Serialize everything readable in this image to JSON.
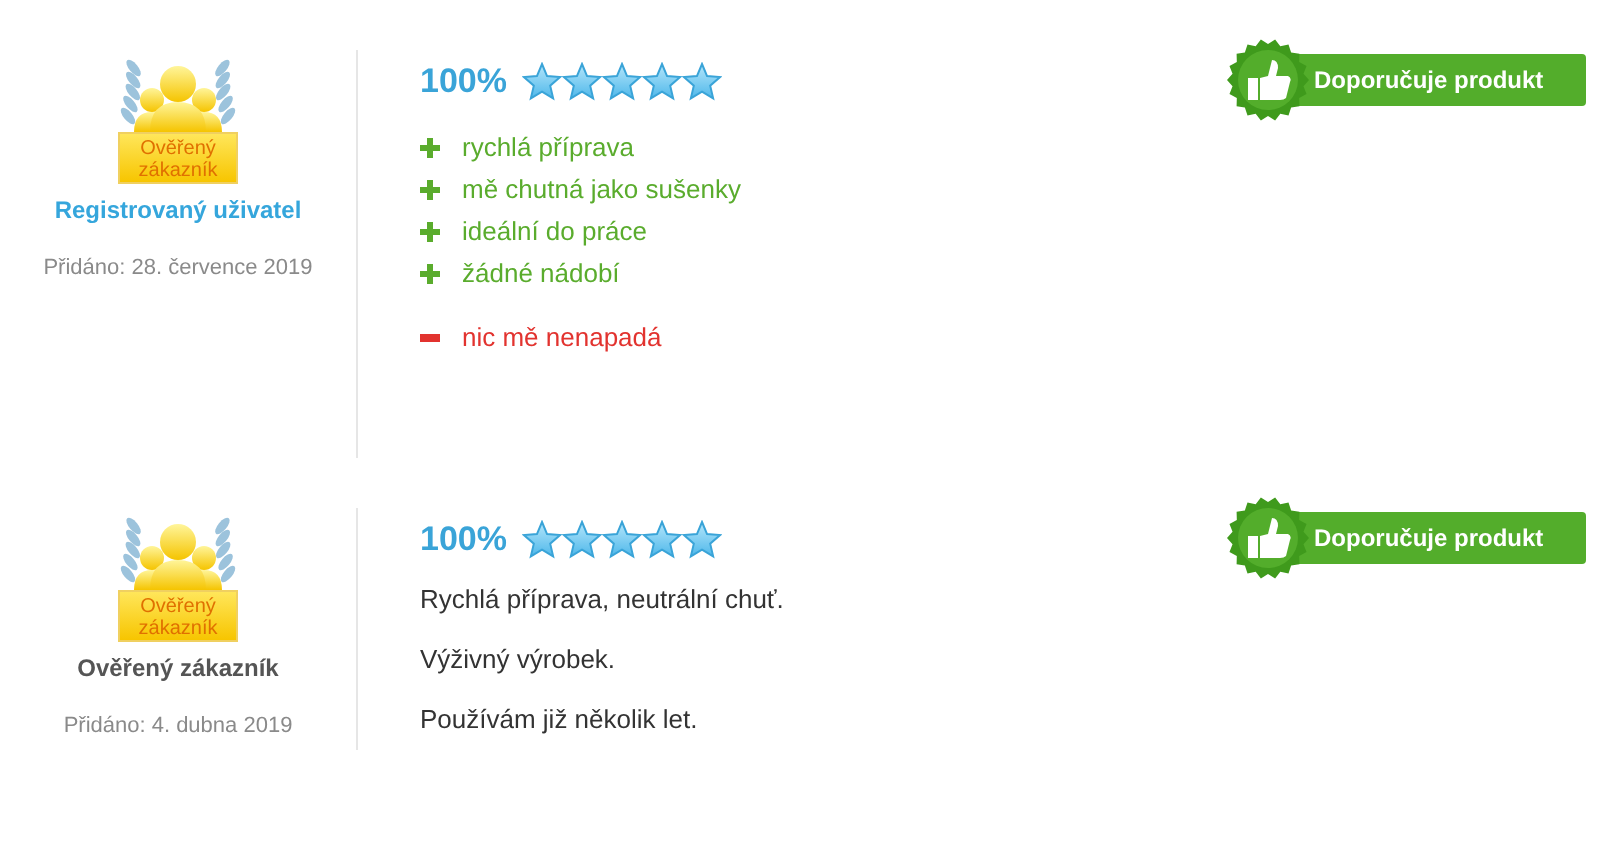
{
  "reviews": [
    {
      "badge_label": "Ověřený zákazník",
      "author": {
        "name": "Registrovaný uživatel",
        "kind": "registered"
      },
      "date": "Přidáno: 28. července 2019",
      "score": "100%",
      "stars": 5,
      "recommendation": {
        "recommends": true,
        "label": "Doporučuje produkt"
      },
      "body": {
        "kind": "pros_cons",
        "pros": [
          "rychlá příprava",
          "mě chutná jako sušenky",
          "ideální do práce",
          "žádné nádobí"
        ],
        "cons": [
          "nic mě nenapadá"
        ]
      }
    },
    {
      "badge_label": "Ověřený zákazník",
      "author": {
        "name": "Ověřený zákazník",
        "kind": "verified"
      },
      "date": "Přidáno: 4. dubna 2019",
      "score": "100%",
      "stars": 5,
      "recommendation": {
        "recommends": true,
        "label": "Doporučuje produkt"
      },
      "body": {
        "kind": "text",
        "paragraphs": [
          "Rychlá příprava, neutrální chuť.",
          "Výživný výrobek.",
          "Používám již několik let."
        ]
      }
    }
  ]
}
